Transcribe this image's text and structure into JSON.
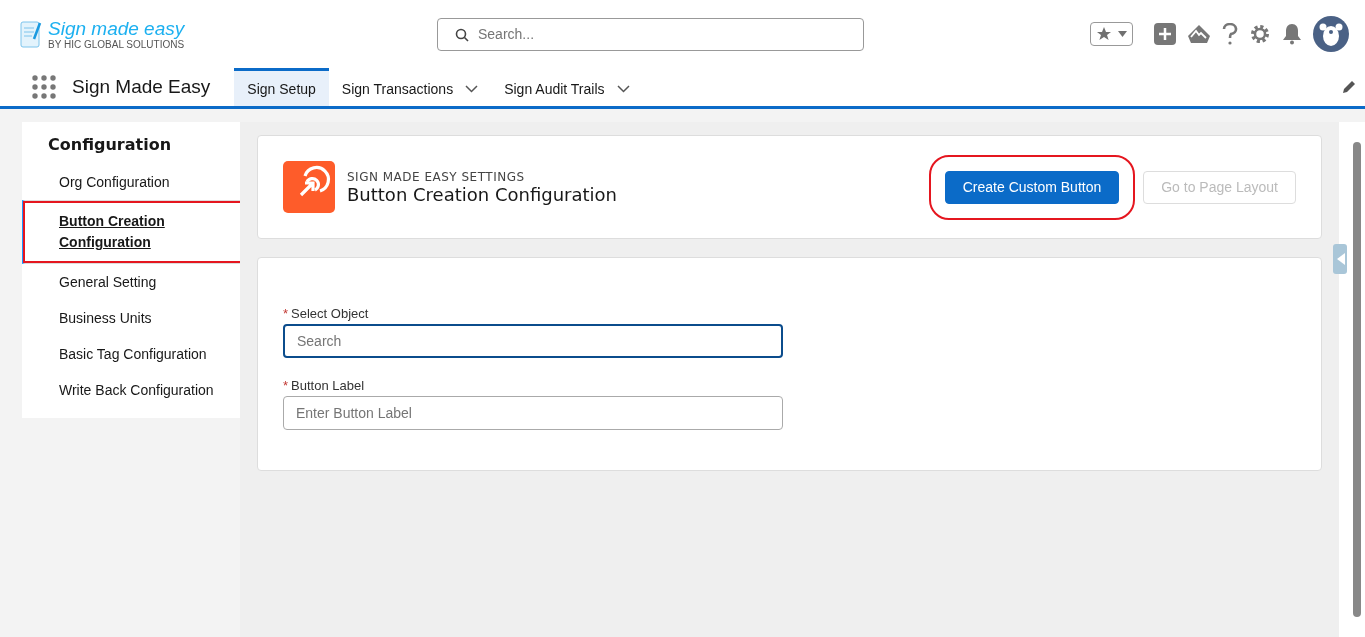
{
  "brand": {
    "title": "Sign made easy",
    "subtitle": "BY HIC GLOBAL SOLUTIONS"
  },
  "search": {
    "placeholder": "Search..."
  },
  "nav": {
    "app_name": "Sign Made Easy",
    "tabs": [
      {
        "label": "Sign Setup",
        "selected": true,
        "dropdown": false
      },
      {
        "label": "Sign Transactions",
        "selected": false,
        "dropdown": true
      },
      {
        "label": "Sign Audit Trails",
        "selected": false,
        "dropdown": true
      }
    ]
  },
  "sidebar": {
    "title": "Configuration",
    "items": [
      {
        "label": "Org Configuration",
        "selected": false,
        "highlighted": false
      },
      {
        "label": "Button Creation Configuration",
        "selected": true,
        "highlighted": true
      },
      {
        "label": "General Setting",
        "selected": false,
        "highlighted": false
      },
      {
        "label": "Business Units",
        "selected": false,
        "highlighted": false
      },
      {
        "label": "Basic Tag Configuration",
        "selected": false,
        "highlighted": false
      },
      {
        "label": "Write Back Configuration",
        "selected": false,
        "highlighted": false
      }
    ]
  },
  "header_card": {
    "eyebrow": "SIGN MADE EASY SETTINGS",
    "title": "Button Creation Configuration",
    "buttons": [
      {
        "label": "Create Custom Button",
        "kind": "primary",
        "disabled": false,
        "highlighted": true
      },
      {
        "label": "Go to Page Layout",
        "kind": "neutral",
        "disabled": true,
        "highlighted": false
      }
    ]
  },
  "form": {
    "fields": [
      {
        "label": "Select Object",
        "required_mark": "*",
        "placeholder": "Search",
        "focused": true
      },
      {
        "label": "Button Label",
        "required_mark": "*",
        "placeholder": "Enter Button Label",
        "focused": false
      }
    ]
  }
}
